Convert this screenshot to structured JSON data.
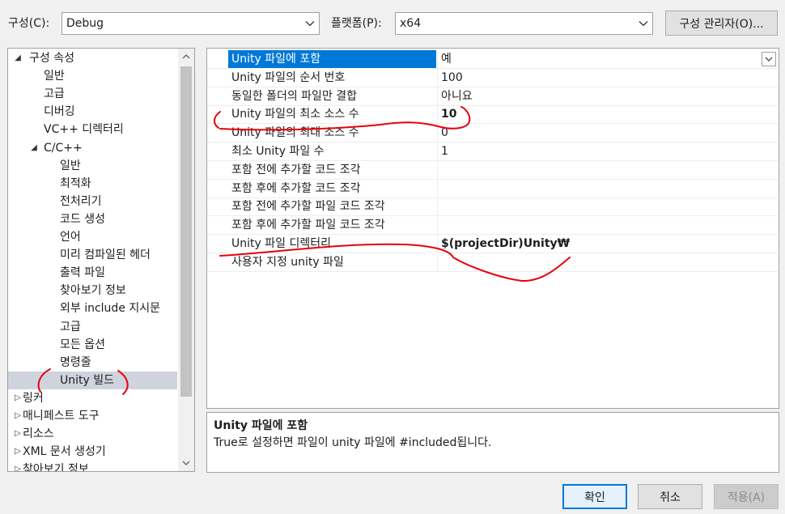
{
  "toolbar": {
    "config_label": "구성(C):",
    "config_value": "Debug",
    "platform_label": "플랫폼(P):",
    "platform_value": "x64",
    "config_manager_button": "구성 관리자(O)..."
  },
  "tree": {
    "items": [
      {
        "label": "구성 속성",
        "expander": "◢"
      },
      {
        "label": "일반"
      },
      {
        "label": "고급"
      },
      {
        "label": "디버깅"
      },
      {
        "label": "VC++ 디렉터리"
      },
      {
        "label": "C/C++",
        "expander": "◢"
      },
      {
        "label": "일반"
      },
      {
        "label": "최적화"
      },
      {
        "label": "전처리기"
      },
      {
        "label": "코드 생성"
      },
      {
        "label": "언어"
      },
      {
        "label": "미리 컴파일된 헤더"
      },
      {
        "label": "출력 파일"
      },
      {
        "label": "찾아보기 정보"
      },
      {
        "label": "외부 include 지시문"
      },
      {
        "label": "고급"
      },
      {
        "label": "모든 옵션"
      },
      {
        "label": "명령줄"
      },
      {
        "label": "Unity 빌드",
        "selected": true
      },
      {
        "label": "링커",
        "expander": "▷"
      },
      {
        "label": "매니페스트 도구",
        "expander": "▷"
      },
      {
        "label": "리소스",
        "expander": "▷"
      },
      {
        "label": "XML 문서 생성기",
        "expander": "▷"
      },
      {
        "label": "찾아보기 정보",
        "expander": "▷"
      }
    ]
  },
  "grid": {
    "rows": [
      {
        "name": "Unity 파일에 포함",
        "value": "예",
        "selected": true
      },
      {
        "name": "Unity 파일의 순서 번호",
        "value": "100"
      },
      {
        "name": "동일한 폴더의 파일만 결합",
        "value": "아니요"
      },
      {
        "name": "Unity 파일의 최소 소스 수",
        "value": "10",
        "bold": true
      },
      {
        "name": "Unity 파일의 최대 소스 수",
        "value": "0"
      },
      {
        "name": "최소 Unity 파일 수",
        "value": "1"
      },
      {
        "name": "포함 전에 추가할 코드 조각",
        "value": ""
      },
      {
        "name": "포함 후에 추가할 코드 조각",
        "value": ""
      },
      {
        "name": "포함 전에 추가할 파일 코드 조각",
        "value": ""
      },
      {
        "name": "포함 후에 추가할 파일 코드 조각",
        "value": ""
      },
      {
        "name": "Unity 파일 디렉터리",
        "value": "$(projectDir)Unity₩",
        "bold": true
      },
      {
        "name": "사용자 지정 unity 파일",
        "value": ""
      }
    ]
  },
  "description": {
    "title": "Unity 파일에 포함",
    "body": "True로 설정하면 파일이 unity 파일에 #included됩니다."
  },
  "buttons": {
    "ok": "확인",
    "cancel": "취소",
    "apply": "적용(A)"
  },
  "icons": {
    "dropdown": "chevron-down-icon",
    "scroll_up": "chevron-up-icon",
    "scroll_down": "chevron-down-icon"
  },
  "colors": {
    "selection_blue": "#0078d7",
    "tree_selection": "#cfd3de",
    "annotation_red": "#e8000b"
  }
}
